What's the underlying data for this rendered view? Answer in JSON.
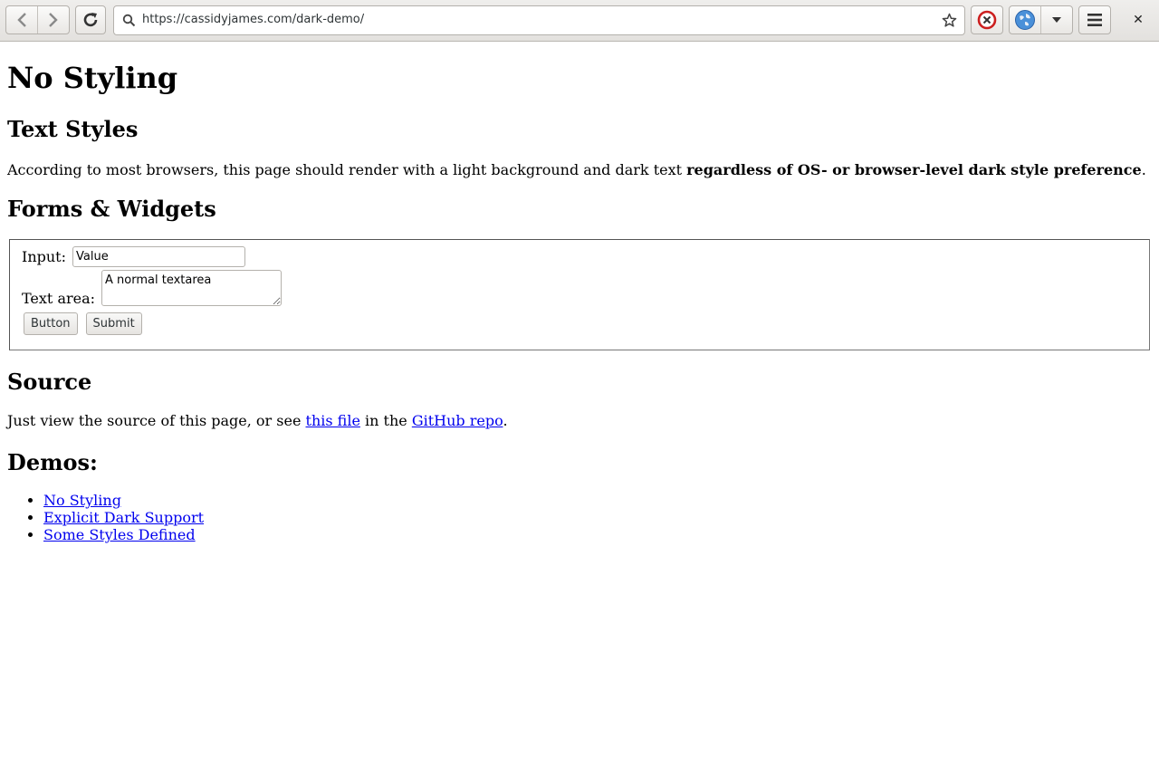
{
  "browser": {
    "url": "https://cassidyjames.com/dark-demo/",
    "icons": {
      "back": "back-arrow-icon",
      "forward": "forward-arrow-icon",
      "reload": "reload-icon",
      "search": "search-icon",
      "bookmark": "star-icon",
      "stop": "stop-icon",
      "globe": "globe-icon",
      "dropdown": "chevron-down-icon",
      "menu": "hamburger-menu-icon",
      "close": "close-icon"
    },
    "close_glyph": "✕"
  },
  "page": {
    "title": "No Styling",
    "text_styles_heading": "Text Styles",
    "text_styles_body": "According to most browsers, this page should render with a light background and dark text ",
    "text_styles_bold": "regardless of OS- or browser-level dark style preference",
    "text_styles_end": ".",
    "forms_heading": "Forms & Widgets",
    "form": {
      "input_label": "Input:",
      "input_value": "Value",
      "textarea_label": "Text area:",
      "textarea_value": "A normal textarea",
      "button_label": "Button",
      "submit_label": "Submit"
    },
    "source_heading": "Source",
    "source_text_1": "Just view the source of this page, or see ",
    "source_link_1": "this file",
    "source_text_2": " in the ",
    "source_link_2": "GitHub repo",
    "source_text_3": ".",
    "demos_heading": "Demos:",
    "demos": [
      {
        "label": "No Styling"
      },
      {
        "label": "Explicit Dark Support"
      },
      {
        "label": "Some Styles Defined"
      }
    ]
  }
}
